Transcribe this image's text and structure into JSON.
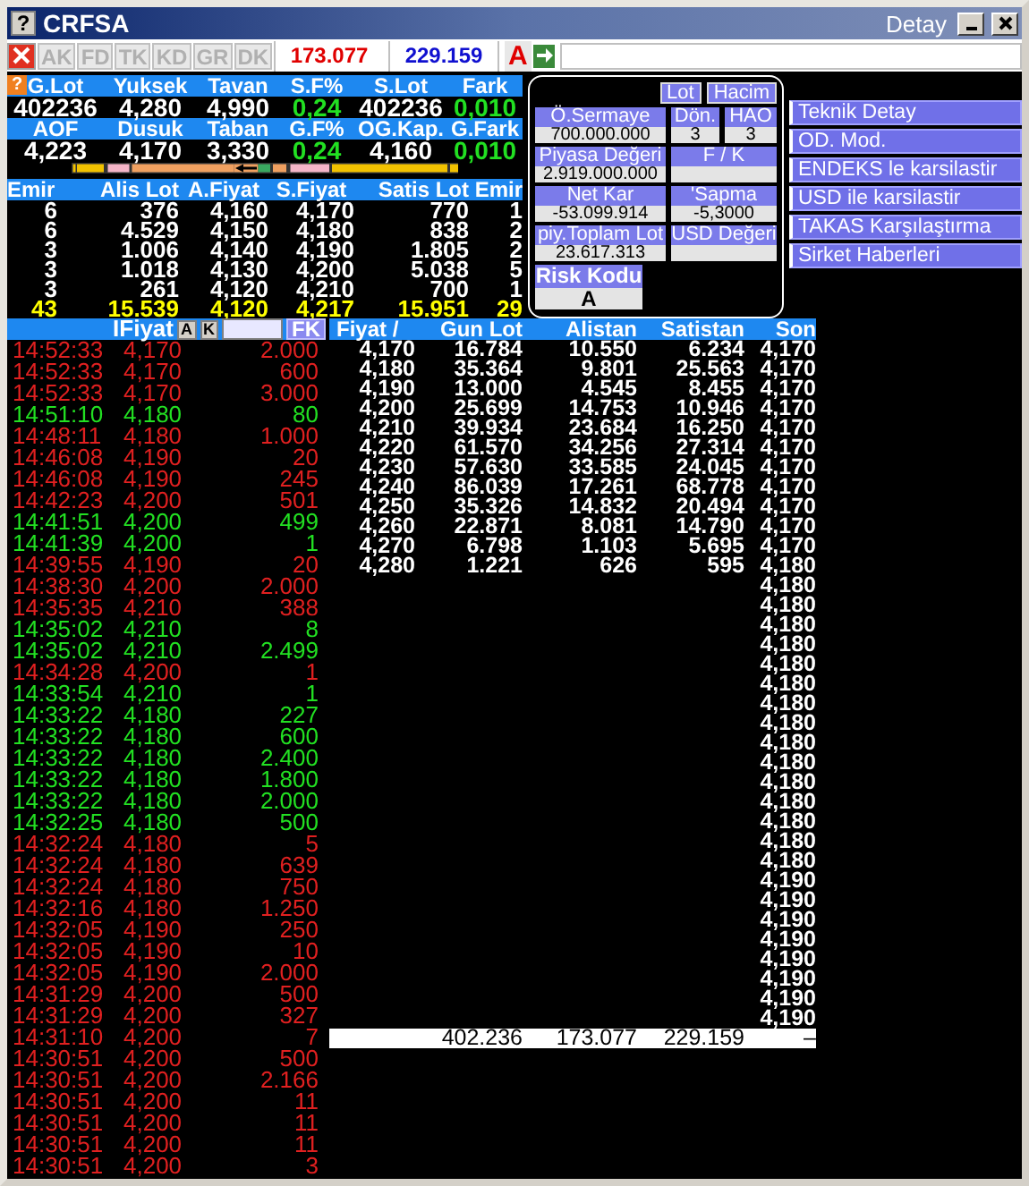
{
  "window": {
    "help_glyph": "?",
    "title": "CRFSA",
    "detail_label": "Detay"
  },
  "toolbar": {
    "tabs": [
      {
        "label": "AK",
        "disabled": true
      },
      {
        "label": "FD",
        "disabled": true
      },
      {
        "label": "TK",
        "disabled": true
      },
      {
        "label": "KD",
        "disabled": true
      },
      {
        "label": "GR",
        "disabled": true
      },
      {
        "label": "DK",
        "disabled": true
      }
    ],
    "buy_total": "173.077",
    "sell_total": "229.159",
    "grade": "A"
  },
  "summary": {
    "help_glyph": "?",
    "groups": [
      {
        "headers": [
          "G.Lot",
          "Yuksek",
          "Tavan",
          "S.F%",
          "S.Lot",
          "Fark"
        ],
        "values": [
          {
            "text": "402236",
            "change": false
          },
          {
            "text": "4,280",
            "change": false
          },
          {
            "text": "4,990",
            "change": false
          },
          {
            "text": "0,24",
            "change": true
          },
          {
            "text": "402236",
            "change": false
          },
          {
            "text": "0,010",
            "change": true
          }
        ]
      },
      {
        "headers": [
          "AOF",
          "Dusuk",
          "Taban",
          "G.F%",
          "OG.Kap.",
          "G.Fark"
        ],
        "values": [
          {
            "text": "4,223",
            "change": false
          },
          {
            "text": "4,170",
            "change": false
          },
          {
            "text": "3,330",
            "change": false
          },
          {
            "text": "0,24",
            "change": true
          },
          {
            "text": "4,160",
            "change": false
          },
          {
            "text": "0,010",
            "change": true
          }
        ]
      }
    ]
  },
  "depth": {
    "columns": [
      "Emir",
      "Alis Lot",
      "A.Fiyat",
      "S.Fiyat",
      "Satis Lot",
      "Emir"
    ],
    "rows": [
      [
        "6",
        "376",
        "4,160",
        "4,170",
        "770",
        "1"
      ],
      [
        "6",
        "4.529",
        "4,150",
        "4,180",
        "838",
        "2"
      ],
      [
        "3",
        "1.006",
        "4,140",
        "4,190",
        "1.805",
        "2"
      ],
      [
        "3",
        "1.018",
        "4,130",
        "4,200",
        "5.038",
        "5"
      ],
      [
        "3",
        "261",
        "4,120",
        "4,210",
        "700",
        "1"
      ]
    ],
    "totals": [
      "43",
      "15.539",
      "4,120",
      "4,217",
      "15.951",
      "29"
    ]
  },
  "fundamentals": {
    "toggles": [
      "Lot",
      "Hacim"
    ],
    "field_rows": [
      [
        {
          "label": "Ö.Sermaye",
          "value": "700.000.000"
        },
        {
          "label": "Dön.",
          "value": "3"
        },
        {
          "label": "HAO",
          "value": "3"
        }
      ],
      [
        {
          "label": "Piyasa Değeri",
          "value": "2.919.000.000"
        },
        {
          "label": "F / K"
        }
      ],
      [
        {
          "label": "Net Kar",
          "value": "-53.099.914"
        },
        {
          "label": "'Sapma",
          "value": "-5,3000"
        }
      ],
      [
        {
          "label": "piy.Toplam Lot",
          "value": "23.617.313"
        },
        {
          "label": "USD Değeri"
        }
      ]
    ],
    "risk": {
      "label": "Risk Kodu",
      "value": "A"
    }
  },
  "actions": [
    "Teknik Detay",
    "OD. Mod.",
    "ENDEKS le karsilastir",
    "USD ile karsilastir",
    "TAKAS Karşılaştırma",
    "Sirket Haberleri"
  ],
  "trades": {
    "header": "IFiyat",
    "a_button": "A",
    "k_button": "K",
    "fk_button": "FK",
    "rows": [
      {
        "time": "14:52:33",
        "price": "4,170",
        "lot": "2.000",
        "up": false
      },
      {
        "time": "14:52:33",
        "price": "4,170",
        "lot": "600",
        "up": false
      },
      {
        "time": "14:52:33",
        "price": "4,170",
        "lot": "3.000",
        "up": false
      },
      {
        "time": "14:51:10",
        "price": "4,180",
        "lot": "80",
        "up": true
      },
      {
        "time": "14:48:11",
        "price": "4,180",
        "lot": "1.000",
        "up": false
      },
      {
        "time": "14:46:08",
        "price": "4,190",
        "lot": "20",
        "up": false
      },
      {
        "time": "14:46:08",
        "price": "4,190",
        "lot": "245",
        "up": false
      },
      {
        "time": "14:42:23",
        "price": "4,200",
        "lot": "501",
        "up": false
      },
      {
        "time": "14:41:51",
        "price": "4,200",
        "lot": "499",
        "up": true
      },
      {
        "time": "14:41:39",
        "price": "4,200",
        "lot": "1",
        "up": true
      },
      {
        "time": "14:39:55",
        "price": "4,190",
        "lot": "20",
        "up": false
      },
      {
        "time": "14:38:30",
        "price": "4,200",
        "lot": "2.000",
        "up": false
      },
      {
        "time": "14:35:35",
        "price": "4,210",
        "lot": "388",
        "up": false
      },
      {
        "time": "14:35:02",
        "price": "4,210",
        "lot": "8",
        "up": true
      },
      {
        "time": "14:35:02",
        "price": "4,210",
        "lot": "2.499",
        "up": true
      },
      {
        "time": "14:34:28",
        "price": "4,200",
        "lot": "1",
        "up": false
      },
      {
        "time": "14:33:54",
        "price": "4,210",
        "lot": "1",
        "up": true
      },
      {
        "time": "14:33:22",
        "price": "4,180",
        "lot": "227",
        "up": true
      },
      {
        "time": "14:33:22",
        "price": "4,180",
        "lot": "600",
        "up": true
      },
      {
        "time": "14:33:22",
        "price": "4,180",
        "lot": "2.400",
        "up": true
      },
      {
        "time": "14:33:22",
        "price": "4,180",
        "lot": "1.800",
        "up": true
      },
      {
        "time": "14:33:22",
        "price": "4,180",
        "lot": "2.000",
        "up": true
      },
      {
        "time": "14:32:25",
        "price": "4,180",
        "lot": "500",
        "up": true
      },
      {
        "time": "14:32:24",
        "price": "4,180",
        "lot": "5",
        "up": false
      },
      {
        "time": "14:32:24",
        "price": "4,180",
        "lot": "639",
        "up": false
      },
      {
        "time": "14:32:24",
        "price": "4,180",
        "lot": "750",
        "up": false
      },
      {
        "time": "14:32:16",
        "price": "4,180",
        "lot": "1.250",
        "up": false
      },
      {
        "time": "14:32:05",
        "price": "4,190",
        "lot": "250",
        "up": false
      },
      {
        "time": "14:32:05",
        "price": "4,190",
        "lot": "10",
        "up": false
      },
      {
        "time": "14:32:05",
        "price": "4,190",
        "lot": "2.000",
        "up": false
      },
      {
        "time": "14:31:29",
        "price": "4,200",
        "lot": "500",
        "up": false
      },
      {
        "time": "14:31:29",
        "price": "4,200",
        "lot": "327",
        "up": false
      },
      {
        "time": "14:31:10",
        "price": "4,200",
        "lot": "7",
        "up": false
      },
      {
        "time": "14:30:51",
        "price": "4,200",
        "lot": "500",
        "up": false
      },
      {
        "time": "14:30:51",
        "price": "4,200",
        "lot": "2.166",
        "up": false
      },
      {
        "time": "14:30:51",
        "price": "4,200",
        "lot": "11",
        "up": false
      },
      {
        "time": "14:30:51",
        "price": "4,200",
        "lot": "11",
        "up": false
      },
      {
        "time": "14:30:51",
        "price": "4,200",
        "lot": "11",
        "up": false
      },
      {
        "time": "14:30:51",
        "price": "4,200",
        "lot": "3",
        "up": false
      }
    ]
  },
  "price_table": {
    "columns": [
      "Fiyat /",
      "Gun Lot",
      "Alistan",
      "Satistan",
      "Son"
    ],
    "rows": [
      [
        "4,170",
        "16.784",
        "10.550",
        "6.234",
        "4,170"
      ],
      [
        "4,180",
        "35.364",
        "9.801",
        "25.563",
        "4,170"
      ],
      [
        "4,190",
        "13.000",
        "4.545",
        "8.455",
        "4,170"
      ],
      [
        "4,200",
        "25.699",
        "14.753",
        "10.946",
        "4,170"
      ],
      [
        "4,210",
        "39.934",
        "23.684",
        "16.250",
        "4,170"
      ],
      [
        "4,220",
        "61.570",
        "34.256",
        "27.314",
        "4,170"
      ],
      [
        "4,230",
        "57.630",
        "33.585",
        "24.045",
        "4,170"
      ],
      [
        "4,240",
        "86.039",
        "17.261",
        "68.778",
        "4,170"
      ],
      [
        "4,250",
        "35.326",
        "14.832",
        "20.494",
        "4,170"
      ],
      [
        "4,260",
        "22.871",
        "8.081",
        "14.790",
        "4,170"
      ],
      [
        "4,270",
        "6.798",
        "1.103",
        "5.695",
        "4,170"
      ],
      [
        "4,280",
        "1.221",
        "626",
        "595",
        "4,180"
      ]
    ],
    "last_only": [
      "4,180",
      "4,180",
      "4,180",
      "4,180",
      "4,180",
      "4,180",
      "4,180",
      "4,180",
      "4,180",
      "4,180",
      "4,180",
      "4,180",
      "4,180",
      "4,180",
      "4,180",
      "4,190",
      "4,190",
      "4,190",
      "4,190",
      "4,190",
      "4,190",
      "4,190",
      "4,190"
    ],
    "totals": [
      "402.236",
      "173.077",
      "229.159",
      "–"
    ]
  }
}
